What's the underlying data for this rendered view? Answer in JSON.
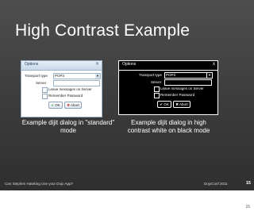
{
  "slide": {
    "title": "High Contrast Example",
    "footer_left": "Can Stephen Hawking Use your Dojo App?",
    "footer_right": "DojoConf 2011",
    "page_number": "15"
  },
  "dialog_standard": {
    "title": "Options",
    "transport_label": "Transport type",
    "transport_value": "POP3",
    "server_label": "Server",
    "leave_messages": "Leave messages on Server",
    "remember_password": "Remember Password",
    "ok": "OK",
    "abort": "Abort",
    "caption": "Example dijit dialog in \"standard\" mode"
  },
  "dialog_hc": {
    "title": "Options",
    "close": "x",
    "transport_label": "Transport type",
    "transport_value": "POP3",
    "server_label": "Server",
    "leave_messages": "Leave messages on Server",
    "remember_password": "Remember Password",
    "ok": "OK",
    "abort": "Abort",
    "caption": "Example dijit dialog in high contrast white on black mode"
  },
  "page_number_below": "15"
}
